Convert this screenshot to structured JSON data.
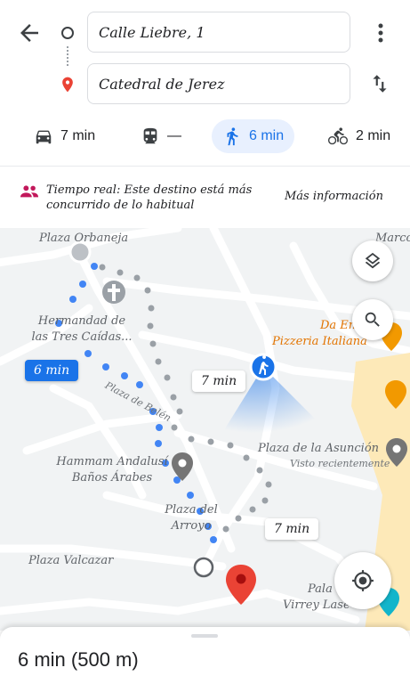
{
  "header": {
    "origin_value": "Calle Liebre, 1",
    "destination_value": "Catedral de Jerez"
  },
  "modes": [
    {
      "name": "car",
      "label": "7 min"
    },
    {
      "name": "transit",
      "label": "—"
    },
    {
      "name": "walk",
      "label": "6 min",
      "active": true
    },
    {
      "name": "bike",
      "label": "2 min"
    }
  ],
  "alert": {
    "text": "Tiempo real: Este destino está más concurrido de lo habitual",
    "link": "Más información"
  },
  "map": {
    "labels": {
      "plaza_orbaneja": "Plaza Orbaneja",
      "marco": "Marco",
      "hermandad": "Hermandad de las Tres Caídas...",
      "da_enzo": "Da En",
      "pizzeria": "Pizzeria Italiana",
      "plaza_belen": "Plaza de Belén",
      "plaza_asuncion": "Plaza de la Asunción",
      "visto": "Visto recientemente",
      "hammam": "Hammam Andalusí Baños Árabes",
      "plaza_arroyo": "Plaza del Arroyo",
      "plaza_valcazar": "Plaza Valcazar",
      "palacio": "Pala",
      "virrey": "Virrey Lase"
    },
    "chips": {
      "walk_alt": "7 min",
      "selected": "6 min",
      "alt2": "7 min"
    }
  },
  "sheet": {
    "summary": "6 min (500 m)"
  },
  "colors": {
    "accent": "#1a73e8",
    "red_pin": "#ea4335",
    "orange": "#f29900"
  }
}
